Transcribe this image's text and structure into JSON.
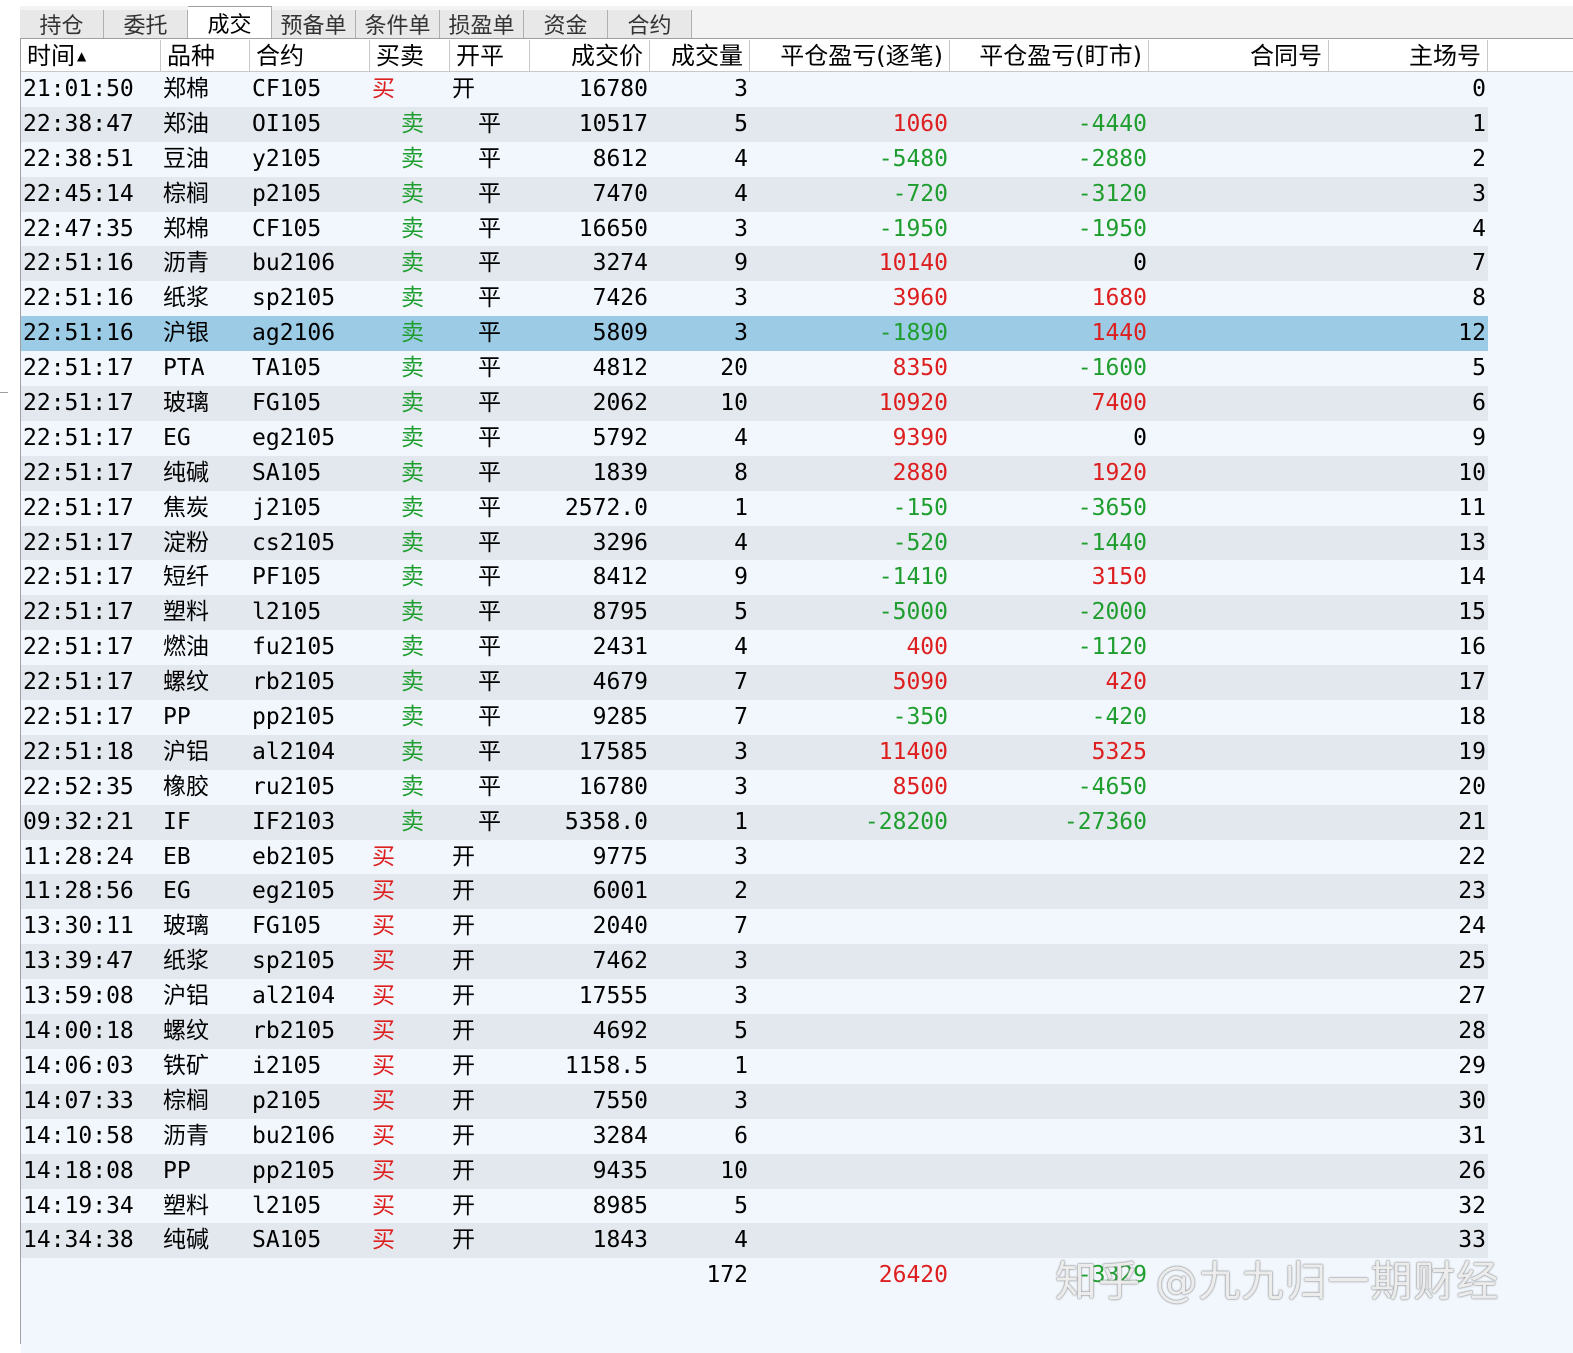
{
  "tabs": [
    "持仓",
    "委托",
    "成交",
    "预备单",
    "条件单",
    "损盈单",
    "资金",
    "合约"
  ],
  "active_tab": 2,
  "columns": {
    "time": "时间",
    "variety": "品种",
    "contract": "合约",
    "direction": "买卖",
    "open_close": "开平",
    "price": "成交价",
    "volume": "成交量",
    "pnl_per_trade": "平仓盈亏(逐笔)",
    "pnl_mtm": "平仓盈亏(盯市)",
    "contract_no": "合同号",
    "venue_no": "主场号"
  },
  "sort_indicator": "▲",
  "rows": [
    {
      "time": "21:01:50",
      "variety": "郑棉",
      "contract": "CF105",
      "direction": "买",
      "open_close": "开",
      "price": "16780",
      "volume": "3",
      "pnl_per_trade": "",
      "pnl_mtm": "",
      "contract_no": "",
      "venue_no": "0"
    },
    {
      "time": "22:38:47",
      "variety": "郑油",
      "contract": "OI105",
      "direction": "卖",
      "open_close": "平",
      "price": "10517",
      "volume": "5",
      "pnl_per_trade": "1060",
      "pnl_mtm": "-4440",
      "contract_no": "",
      "venue_no": "1"
    },
    {
      "time": "22:38:51",
      "variety": "豆油",
      "contract": "y2105",
      "direction": "卖",
      "open_close": "平",
      "price": "8612",
      "volume": "4",
      "pnl_per_trade": "-5480",
      "pnl_mtm": "-2880",
      "contract_no": "",
      "venue_no": "2"
    },
    {
      "time": "22:45:14",
      "variety": "棕榈",
      "contract": "p2105",
      "direction": "卖",
      "open_close": "平",
      "price": "7470",
      "volume": "4",
      "pnl_per_trade": "-720",
      "pnl_mtm": "-3120",
      "contract_no": "",
      "venue_no": "3"
    },
    {
      "time": "22:47:35",
      "variety": "郑棉",
      "contract": "CF105",
      "direction": "卖",
      "open_close": "平",
      "price": "16650",
      "volume": "3",
      "pnl_per_trade": "-1950",
      "pnl_mtm": "-1950",
      "contract_no": "",
      "venue_no": "4"
    },
    {
      "time": "22:51:16",
      "variety": "沥青",
      "contract": "bu2106",
      "direction": "卖",
      "open_close": "平",
      "price": "3274",
      "volume": "9",
      "pnl_per_trade": "10140",
      "pnl_mtm": "0",
      "contract_no": "",
      "venue_no": "7"
    },
    {
      "time": "22:51:16",
      "variety": "纸浆",
      "contract": "sp2105",
      "direction": "卖",
      "open_close": "平",
      "price": "7426",
      "volume": "3",
      "pnl_per_trade": "3960",
      "pnl_mtm": "1680",
      "contract_no": "",
      "venue_no": "8"
    },
    {
      "time": "22:51:16",
      "variety": "沪银",
      "contract": "ag2106",
      "direction": "卖",
      "open_close": "平",
      "price": "5809",
      "volume": "3",
      "pnl_per_trade": "-1890",
      "pnl_mtm": "1440",
      "contract_no": "",
      "venue_no": "12",
      "selected": true
    },
    {
      "time": "22:51:17",
      "variety": "PTA",
      "contract": "TA105",
      "direction": "卖",
      "open_close": "平",
      "price": "4812",
      "volume": "20",
      "pnl_per_trade": "8350",
      "pnl_mtm": "-1600",
      "contract_no": "",
      "venue_no": "5"
    },
    {
      "time": "22:51:17",
      "variety": "玻璃",
      "contract": "FG105",
      "direction": "卖",
      "open_close": "平",
      "price": "2062",
      "volume": "10",
      "pnl_per_trade": "10920",
      "pnl_mtm": "7400",
      "contract_no": "",
      "venue_no": "6"
    },
    {
      "time": "22:51:17",
      "variety": "EG",
      "contract": "eg2105",
      "direction": "卖",
      "open_close": "平",
      "price": "5792",
      "volume": "4",
      "pnl_per_trade": "9390",
      "pnl_mtm": "0",
      "contract_no": "",
      "venue_no": "9"
    },
    {
      "time": "22:51:17",
      "variety": "纯碱",
      "contract": "SA105",
      "direction": "卖",
      "open_close": "平",
      "price": "1839",
      "volume": "8",
      "pnl_per_trade": "2880",
      "pnl_mtm": "1920",
      "contract_no": "",
      "venue_no": "10"
    },
    {
      "time": "22:51:17",
      "variety": "焦炭",
      "contract": "j2105",
      "direction": "卖",
      "open_close": "平",
      "price": "2572.0",
      "volume": "1",
      "pnl_per_trade": "-150",
      "pnl_mtm": "-3650",
      "contract_no": "",
      "venue_no": "11"
    },
    {
      "time": "22:51:17",
      "variety": "淀粉",
      "contract": "cs2105",
      "direction": "卖",
      "open_close": "平",
      "price": "3296",
      "volume": "4",
      "pnl_per_trade": "-520",
      "pnl_mtm": "-1440",
      "contract_no": "",
      "venue_no": "13"
    },
    {
      "time": "22:51:17",
      "variety": "短纤",
      "contract": "PF105",
      "direction": "卖",
      "open_close": "平",
      "price": "8412",
      "volume": "9",
      "pnl_per_trade": "-1410",
      "pnl_mtm": "3150",
      "contract_no": "",
      "venue_no": "14"
    },
    {
      "time": "22:51:17",
      "variety": "塑料",
      "contract": "l2105",
      "direction": "卖",
      "open_close": "平",
      "price": "8795",
      "volume": "5",
      "pnl_per_trade": "-5000",
      "pnl_mtm": "-2000",
      "contract_no": "",
      "venue_no": "15"
    },
    {
      "time": "22:51:17",
      "variety": "燃油",
      "contract": "fu2105",
      "direction": "卖",
      "open_close": "平",
      "price": "2431",
      "volume": "4",
      "pnl_per_trade": "400",
      "pnl_mtm": "-1120",
      "contract_no": "",
      "venue_no": "16"
    },
    {
      "time": "22:51:17",
      "variety": "螺纹",
      "contract": "rb2105",
      "direction": "卖",
      "open_close": "平",
      "price": "4679",
      "volume": "7",
      "pnl_per_trade": "5090",
      "pnl_mtm": "420",
      "contract_no": "",
      "venue_no": "17"
    },
    {
      "time": "22:51:17",
      "variety": "PP",
      "contract": "pp2105",
      "direction": "卖",
      "open_close": "平",
      "price": "9285",
      "volume": "7",
      "pnl_per_trade": "-350",
      "pnl_mtm": "-420",
      "contract_no": "",
      "venue_no": "18"
    },
    {
      "time": "22:51:18",
      "variety": "沪铝",
      "contract": "al2104",
      "direction": "卖",
      "open_close": "平",
      "price": "17585",
      "volume": "3",
      "pnl_per_trade": "11400",
      "pnl_mtm": "5325",
      "contract_no": "",
      "venue_no": "19"
    },
    {
      "time": "22:52:35",
      "variety": "橡胶",
      "contract": "ru2105",
      "direction": "卖",
      "open_close": "平",
      "price": "16780",
      "volume": "3",
      "pnl_per_trade": "8500",
      "pnl_mtm": "-4650",
      "contract_no": "",
      "venue_no": "20"
    },
    {
      "time": "09:32:21",
      "variety": "IF",
      "contract": "IF2103",
      "direction": "卖",
      "open_close": "平",
      "price": "5358.0",
      "volume": "1",
      "pnl_per_trade": "-28200",
      "pnl_mtm": "-27360",
      "contract_no": "",
      "venue_no": "21"
    },
    {
      "time": "11:28:24",
      "variety": "EB",
      "contract": "eb2105",
      "direction": "买",
      "open_close": "开",
      "price": "9775",
      "volume": "3",
      "pnl_per_trade": "",
      "pnl_mtm": "",
      "contract_no": "",
      "venue_no": "22"
    },
    {
      "time": "11:28:56",
      "variety": "EG",
      "contract": "eg2105",
      "direction": "买",
      "open_close": "开",
      "price": "6001",
      "volume": "2",
      "pnl_per_trade": "",
      "pnl_mtm": "",
      "contract_no": "",
      "venue_no": "23"
    },
    {
      "time": "13:30:11",
      "variety": "玻璃",
      "contract": "FG105",
      "direction": "买",
      "open_close": "开",
      "price": "2040",
      "volume": "7",
      "pnl_per_trade": "",
      "pnl_mtm": "",
      "contract_no": "",
      "venue_no": "24"
    },
    {
      "time": "13:39:47",
      "variety": "纸浆",
      "contract": "sp2105",
      "direction": "买",
      "open_close": "开",
      "price": "7462",
      "volume": "3",
      "pnl_per_trade": "",
      "pnl_mtm": "",
      "contract_no": "",
      "venue_no": "25"
    },
    {
      "time": "13:59:08",
      "variety": "沪铝",
      "contract": "al2104",
      "direction": "买",
      "open_close": "开",
      "price": "17555",
      "volume": "3",
      "pnl_per_trade": "",
      "pnl_mtm": "",
      "contract_no": "",
      "venue_no": "27"
    },
    {
      "time": "14:00:18",
      "variety": "螺纹",
      "contract": "rb2105",
      "direction": "买",
      "open_close": "开",
      "price": "4692",
      "volume": "5",
      "pnl_per_trade": "",
      "pnl_mtm": "",
      "contract_no": "",
      "venue_no": "28"
    },
    {
      "time": "14:06:03",
      "variety": "铁矿",
      "contract": "i2105",
      "direction": "买",
      "open_close": "开",
      "price": "1158.5",
      "volume": "1",
      "pnl_per_trade": "",
      "pnl_mtm": "",
      "contract_no": "",
      "venue_no": "29"
    },
    {
      "time": "14:07:33",
      "variety": "棕榈",
      "contract": "p2105",
      "direction": "买",
      "open_close": "开",
      "price": "7550",
      "volume": "3",
      "pnl_per_trade": "",
      "pnl_mtm": "",
      "contract_no": "",
      "venue_no": "30"
    },
    {
      "time": "14:10:58",
      "variety": "沥青",
      "contract": "bu2106",
      "direction": "买",
      "open_close": "开",
      "price": "3284",
      "volume": "6",
      "pnl_per_trade": "",
      "pnl_mtm": "",
      "contract_no": "",
      "venue_no": "31"
    },
    {
      "time": "14:18:08",
      "variety": "PP",
      "contract": "pp2105",
      "direction": "买",
      "open_close": "开",
      "price": "9435",
      "volume": "10",
      "pnl_per_trade": "",
      "pnl_mtm": "",
      "contract_no": "",
      "venue_no": "26"
    },
    {
      "time": "14:19:34",
      "variety": "塑料",
      "contract": "l2105",
      "direction": "买",
      "open_close": "开",
      "price": "8985",
      "volume": "5",
      "pnl_per_trade": "",
      "pnl_mtm": "",
      "contract_no": "",
      "venue_no": "32"
    },
    {
      "time": "14:34:38",
      "variety": "纯碱",
      "contract": "SA105",
      "direction": "买",
      "open_close": "开",
      "price": "1843",
      "volume": "4",
      "pnl_per_trade": "",
      "pnl_mtm": "",
      "contract_no": "",
      "venue_no": "33"
    }
  ],
  "totals": {
    "volume": "172",
    "pnl_per_trade": "26420",
    "pnl_mtm": "-3329"
  },
  "watermark": "知乎 @九九归一期财经",
  "colors": {
    "profit": "#dd1f1f",
    "loss": "#1f9e2f",
    "selected_row": "#9ccbe6",
    "row_light": "#f1f7fd",
    "row_dark": "#e3e8ee"
  }
}
